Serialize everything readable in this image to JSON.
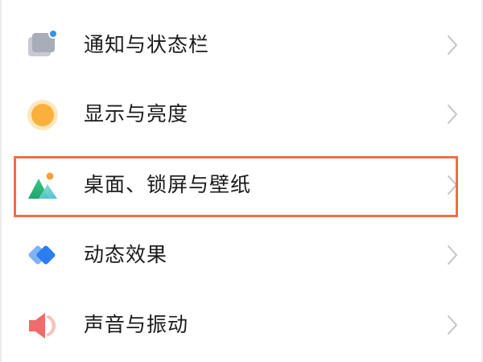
{
  "settings": {
    "items": [
      {
        "label": "通知与状态栏",
        "icon": "notification-icon"
      },
      {
        "label": "显示与亮度",
        "icon": "brightness-icon"
      },
      {
        "label": "桌面、锁屏与壁纸",
        "icon": "wallpaper-icon",
        "highlighted": true
      },
      {
        "label": "动态效果",
        "icon": "animation-icon"
      },
      {
        "label": "声音与振动",
        "icon": "sound-icon"
      }
    ]
  },
  "colors": {
    "highlight_border": "#ec6e48",
    "chevron": "#c4c4c4",
    "text": "#1a1a1a"
  }
}
